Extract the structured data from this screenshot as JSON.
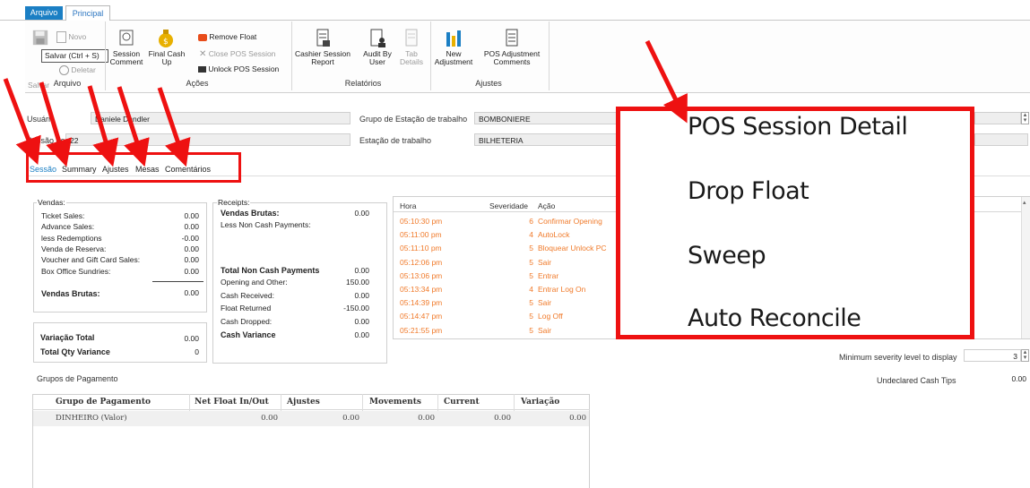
{
  "ribbon": {
    "tabs": [
      "Arquivo",
      "Principal"
    ],
    "tooltip": "Salvar (Ctrl + S)",
    "salvar": "Salvar",
    "novo": "Novo",
    "deletar": "Deletar",
    "session_comment": [
      "Session",
      "Comment"
    ],
    "final_cash_up": [
      "Final Cash",
      "Up"
    ],
    "remove_float": "Remove Float",
    "close_pos_session": "Close POS Session",
    "unlock_pos_session": "Unlock POS Session",
    "cashier_session_report": [
      "Cashier Session",
      "Report"
    ],
    "audit_by_user": [
      "Audit By",
      "User"
    ],
    "tab_details": [
      "Tab",
      "Details"
    ],
    "new_adjustment": [
      "New",
      "Adjustment"
    ],
    "pos_adjustment_comments": [
      "POS Adjustment",
      "Comments"
    ],
    "groups": [
      "Arquivo",
      "Ações",
      "Relatórios",
      "Ajustes"
    ]
  },
  "form": {
    "usuario_label": "Usuário",
    "usuario_value": "Daniele Dandler",
    "sessao_label": "Sessão de PDV",
    "sessao_value": "22",
    "grupo_estacao_label": "Grupo de Estação de trabalho",
    "grupo_estacao_value": "BOMBONIERE",
    "estacao_label": "Estação de trabalho",
    "estacao_value": "BILHETERIA"
  },
  "inner_tabs": [
    "Sessão",
    "Summary",
    "Ajustes",
    "Mesas",
    "Comentários"
  ],
  "vendas": {
    "title": "Vendas:",
    "rows": [
      {
        "label": "Ticket Sales:",
        "value": "0.00"
      },
      {
        "label": "Advance Sales:",
        "value": "0.00"
      },
      {
        "label": "less Redemptions",
        "value": "-0.00"
      },
      {
        "label": "Venda de Reserva:",
        "value": "0.00"
      },
      {
        "label": "Voucher and Gift Card Sales:",
        "value": "0.00"
      },
      {
        "label": "Box Office Sundries:",
        "value": "0.00"
      }
    ],
    "total_label": "Vendas Brutas:",
    "total_value": "0.00"
  },
  "variacao": {
    "total_label": "Variação Total",
    "total_value": "0.00",
    "qty_label": "Total Qty Variance",
    "qty_value": "0"
  },
  "receipts": {
    "title": "Receipts:",
    "vendas_brutas_label": "Vendas Brutas:",
    "vendas_brutas_value": "0.00",
    "less_non_cash": "Less Non Cash Payments:",
    "total_non_cash_label": "Total Non Cash Payments",
    "total_non_cash_value": "0.00",
    "rows": [
      {
        "label": "Opening and Other:",
        "value": "150.00"
      },
      {
        "label": "Cash Received:",
        "value": "0.00"
      },
      {
        "label": "Float Returned",
        "value": "-150.00"
      },
      {
        "label": "Cash Dropped:",
        "value": "0.00"
      }
    ],
    "cash_variance_label": "Cash Variance",
    "cash_variance_value": "0.00"
  },
  "log": {
    "headers": [
      "Hora",
      "Severidade",
      "Ação"
    ],
    "rows": [
      {
        "hora": "05:10:30 pm",
        "sev": "6",
        "acao": "Confirmar  Opening"
      },
      {
        "hora": "05:11:00 pm",
        "sev": "4",
        "acao": "AutoLock"
      },
      {
        "hora": "05:11:10 pm",
        "sev": "5",
        "acao": "Bloquear  Unlock PC"
      },
      {
        "hora": "05:12:06 pm",
        "sev": "5",
        "acao": "Sair"
      },
      {
        "hora": "05:13:06 pm",
        "sev": "5",
        "acao": "Entrar"
      },
      {
        "hora": "05:13:34 pm",
        "sev": "4",
        "acao": "Entrar  Log On"
      },
      {
        "hora": "05:14:39 pm",
        "sev": "5",
        "acao": "Sair"
      },
      {
        "hora": "05:14:47 pm",
        "sev": "5",
        "acao": "Log Off"
      },
      {
        "hora": "05:21:55 pm",
        "sev": "5",
        "acao": "Sair"
      }
    ]
  },
  "severity": {
    "label": "Minimum severity level to display",
    "value": "3"
  },
  "undeclared": {
    "label": "Undeclared Cash Tips",
    "value": "0.00"
  },
  "grupos": {
    "title": "Grupos de Pagamento",
    "headers": [
      "Grupo de Pagamento",
      "Net Float In/Out",
      "Ajustes",
      "Movements",
      "Current",
      "Variação"
    ],
    "row": [
      "DINHEIRO (Valor)",
      "0.00",
      "0.00",
      "0.00",
      "0.00",
      "0.00"
    ]
  },
  "context_menu": {
    "items": [
      "POS Session Detail",
      "Drop Float",
      "Sweep",
      "Auto Reconcile"
    ]
  },
  "colors": {
    "accent": "#1b7fc4",
    "log_text": "#f07a2a",
    "annotation": "#ee1111"
  }
}
